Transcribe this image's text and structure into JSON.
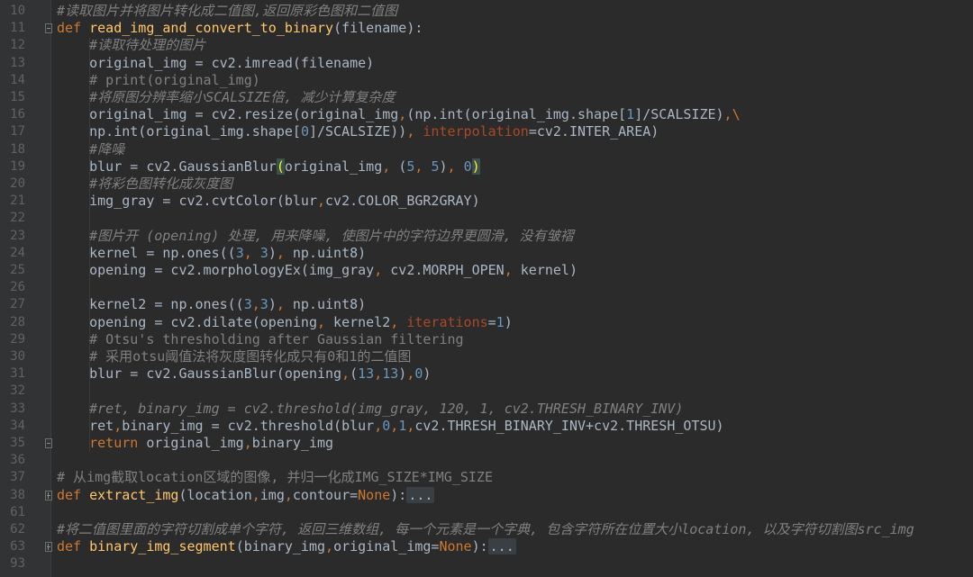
{
  "editor": {
    "colors": {
      "background": "#2b2b2b",
      "gutter": "#313335",
      "keyword": "#cc7832",
      "function": "#ffc66d",
      "number": "#6897bb",
      "comment": "#808080",
      "param": "#aa4926",
      "text": "#a9b7c6"
    },
    "lines": [
      {
        "n": "10",
        "tokens": [
          {
            "t": "#读取图片并将图片转化成二值图,返回原彩色图和二值图",
            "c": "cmi"
          }
        ]
      },
      {
        "n": "11",
        "fold": "minus",
        "tokens": [
          {
            "t": "def ",
            "c": "kw"
          },
          {
            "t": "read_img_and_convert_to_binary",
            "c": "fn"
          },
          {
            "t": "(filename):",
            "c": ""
          }
        ]
      },
      {
        "n": "12",
        "tokens": [
          {
            "t": "    "
          },
          {
            "t": "#读取待处理的图片",
            "c": "cmi"
          }
        ]
      },
      {
        "n": "13",
        "tokens": [
          {
            "t": "    original_img = cv2.imread(filename)"
          }
        ]
      },
      {
        "n": "14",
        "tokens": [
          {
            "t": "    "
          },
          {
            "t": "# print(original_img)",
            "c": "cm"
          }
        ]
      },
      {
        "n": "15",
        "tokens": [
          {
            "t": "    "
          },
          {
            "t": "#将原图分辨率缩小SCALSIZE倍, 减少计算复杂度",
            "c": "cmi"
          }
        ]
      },
      {
        "n": "16",
        "tokens": [
          {
            "t": "    original_img = cv2.resize(original_img"
          },
          {
            "t": ",",
            "c": "kw"
          },
          {
            "t": "(np.int(original_img.shape["
          },
          {
            "t": "1",
            "c": "num"
          },
          {
            "t": "]/SCALSIZE)"
          },
          {
            "t": ",",
            "c": "kw"
          },
          {
            "t": "\\",
            "c": "kw"
          }
        ]
      },
      {
        "n": "17",
        "tokens": [
          {
            "t": "    np.int(original_img.shape["
          },
          {
            "t": "0",
            "c": "num"
          },
          {
            "t": "]/SCALSIZE))"
          },
          {
            "t": ", ",
            "c": "kw"
          },
          {
            "t": "interpolation",
            "c": "par"
          },
          {
            "t": "=cv2.INTER_AREA)"
          }
        ]
      },
      {
        "n": "18",
        "tokens": [
          {
            "t": "    "
          },
          {
            "t": "#降噪",
            "c": "cmi"
          }
        ]
      },
      {
        "n": "19",
        "tokens": [
          {
            "t": "    blur = cv2.GaussianBlur"
          },
          {
            "t": "(",
            "c": "hl"
          },
          {
            "t": "original_img"
          },
          {
            "t": ", ",
            "c": "kw"
          },
          {
            "t": "("
          },
          {
            "t": "5",
            "c": "num"
          },
          {
            "t": ", ",
            "c": "kw"
          },
          {
            "t": "5",
            "c": "num"
          },
          {
            "t": ")"
          },
          {
            "t": ", ",
            "c": "kw"
          },
          {
            "t": "0",
            "c": "num"
          },
          {
            "t": ")",
            "c": "hl"
          }
        ]
      },
      {
        "n": "20",
        "tokens": [
          {
            "t": "    "
          },
          {
            "t": "#将彩色图转化成灰度图",
            "c": "cmi"
          }
        ]
      },
      {
        "n": "21",
        "tokens": [
          {
            "t": "    img_gray = cv2.cvtColor(blur"
          },
          {
            "t": ",",
            "c": "kw"
          },
          {
            "t": "cv2.COLOR_BGR2GRAY)"
          }
        ]
      },
      {
        "n": "22",
        "tokens": []
      },
      {
        "n": "23",
        "tokens": [
          {
            "t": "    "
          },
          {
            "t": "#图片开 (opening) 处理, 用来降噪, 使图片中的字符边界更圆滑, 没有皱褶",
            "c": "cmi"
          }
        ]
      },
      {
        "n": "24",
        "tokens": [
          {
            "t": "    kernel = np.ones(("
          },
          {
            "t": "3",
            "c": "num"
          },
          {
            "t": ", ",
            "c": "kw"
          },
          {
            "t": "3",
            "c": "num"
          },
          {
            "t": ")"
          },
          {
            "t": ", ",
            "c": "kw"
          },
          {
            "t": "np.uint8)"
          }
        ]
      },
      {
        "n": "25",
        "tokens": [
          {
            "t": "    opening = cv2.morphologyEx(img_gray"
          },
          {
            "t": ", ",
            "c": "kw"
          },
          {
            "t": "cv2.MORPH_OPEN"
          },
          {
            "t": ", ",
            "c": "kw"
          },
          {
            "t": "kernel)"
          }
        ]
      },
      {
        "n": "26",
        "tokens": []
      },
      {
        "n": "27",
        "tokens": [
          {
            "t": "    kernel2 = np.ones(("
          },
          {
            "t": "3",
            "c": "num"
          },
          {
            "t": ",",
            "c": "kw"
          },
          {
            "t": "3",
            "c": "num"
          },
          {
            "t": ")"
          },
          {
            "t": ", ",
            "c": "kw"
          },
          {
            "t": "np.uint8)"
          }
        ]
      },
      {
        "n": "28",
        "tokens": [
          {
            "t": "    opening = cv2.dilate(opening"
          },
          {
            "t": ", ",
            "c": "kw"
          },
          {
            "t": "kernel2"
          },
          {
            "t": ", ",
            "c": "kw"
          },
          {
            "t": "iterations",
            "c": "par"
          },
          {
            "t": "="
          },
          {
            "t": "1",
            "c": "num"
          },
          {
            "t": ")"
          }
        ]
      },
      {
        "n": "29",
        "tokens": [
          {
            "t": "    "
          },
          {
            "t": "# Otsu's thresholding after Gaussian filtering",
            "c": "cm"
          }
        ]
      },
      {
        "n": "30",
        "tokens": [
          {
            "t": "    "
          },
          {
            "t": "# 采用otsu阈值法将灰度图转化成只有0和1的二值图",
            "c": "cm"
          }
        ]
      },
      {
        "n": "31",
        "tokens": [
          {
            "t": "    blur = cv2.GaussianBlur(opening"
          },
          {
            "t": ",",
            "c": "kw"
          },
          {
            "t": "("
          },
          {
            "t": "13",
            "c": "num"
          },
          {
            "t": ",",
            "c": "kw"
          },
          {
            "t": "13",
            "c": "num"
          },
          {
            "t": ")"
          },
          {
            "t": ",",
            "c": "kw"
          },
          {
            "t": "0",
            "c": "num"
          },
          {
            "t": ")"
          }
        ]
      },
      {
        "n": "32",
        "tokens": []
      },
      {
        "n": "33",
        "tokens": [
          {
            "t": "    "
          },
          {
            "t": "#ret, binary_img = cv2.threshold(img_gray, 120, 1, cv2.THRESH_BINARY_INV)",
            "c": "cmi"
          }
        ]
      },
      {
        "n": "34",
        "tokens": [
          {
            "t": "    ret"
          },
          {
            "t": ",",
            "c": "kw"
          },
          {
            "t": "binary_img = cv2.threshold(blur"
          },
          {
            "t": ",",
            "c": "kw"
          },
          {
            "t": "0",
            "c": "num"
          },
          {
            "t": ",",
            "c": "kw"
          },
          {
            "t": "1",
            "c": "num"
          },
          {
            "t": ",",
            "c": "kw"
          },
          {
            "t": "cv2.THRESH_BINARY_INV+cv2.THRESH_OTSU)"
          }
        ]
      },
      {
        "n": "35",
        "fold": "minus",
        "tokens": [
          {
            "t": "    "
          },
          {
            "t": "return ",
            "c": "kw"
          },
          {
            "t": "original_img"
          },
          {
            "t": ",",
            "c": "kw"
          },
          {
            "t": "binary_img"
          }
        ]
      },
      {
        "n": "36",
        "tokens": []
      },
      {
        "n": "37",
        "tokens": [
          {
            "t": "# 从img截取location区域的图像, 并归一化成IMG_SIZE*IMG_SIZE",
            "c": "cm"
          }
        ]
      },
      {
        "n": "38",
        "fold": "plus",
        "tokens": [
          {
            "t": "def ",
            "c": "kw"
          },
          {
            "t": "extract_img",
            "c": "fn"
          },
          {
            "t": "(location"
          },
          {
            "t": ",",
            "c": "kw"
          },
          {
            "t": "img"
          },
          {
            "t": ",",
            "c": "kw"
          },
          {
            "t": "contour="
          },
          {
            "t": "None",
            "c": "kw"
          },
          {
            "t": "):"
          },
          {
            "t": "...",
            "c": "fold-ellipsis"
          }
        ]
      },
      {
        "n": "61",
        "tokens": []
      },
      {
        "n": "62",
        "tokens": [
          {
            "t": "#将二值图里面的字符切割成单个字符, 返回三维数组, 每一个元素是一个字典, 包含字符所在位置大小location, 以及字符切割图src_img",
            "c": "cmi"
          }
        ]
      },
      {
        "n": "63",
        "fold": "plus",
        "tokens": [
          {
            "t": "def ",
            "c": "kw"
          },
          {
            "t": "binary_img_segment",
            "c": "fn"
          },
          {
            "t": "(binary_img"
          },
          {
            "t": ",",
            "c": "kw"
          },
          {
            "t": "original_img="
          },
          {
            "t": "None",
            "c": "kw"
          },
          {
            "t": "):"
          },
          {
            "t": "...",
            "c": "fold-ellipsis"
          }
        ]
      },
      {
        "n": "93",
        "tokens": []
      }
    ]
  }
}
